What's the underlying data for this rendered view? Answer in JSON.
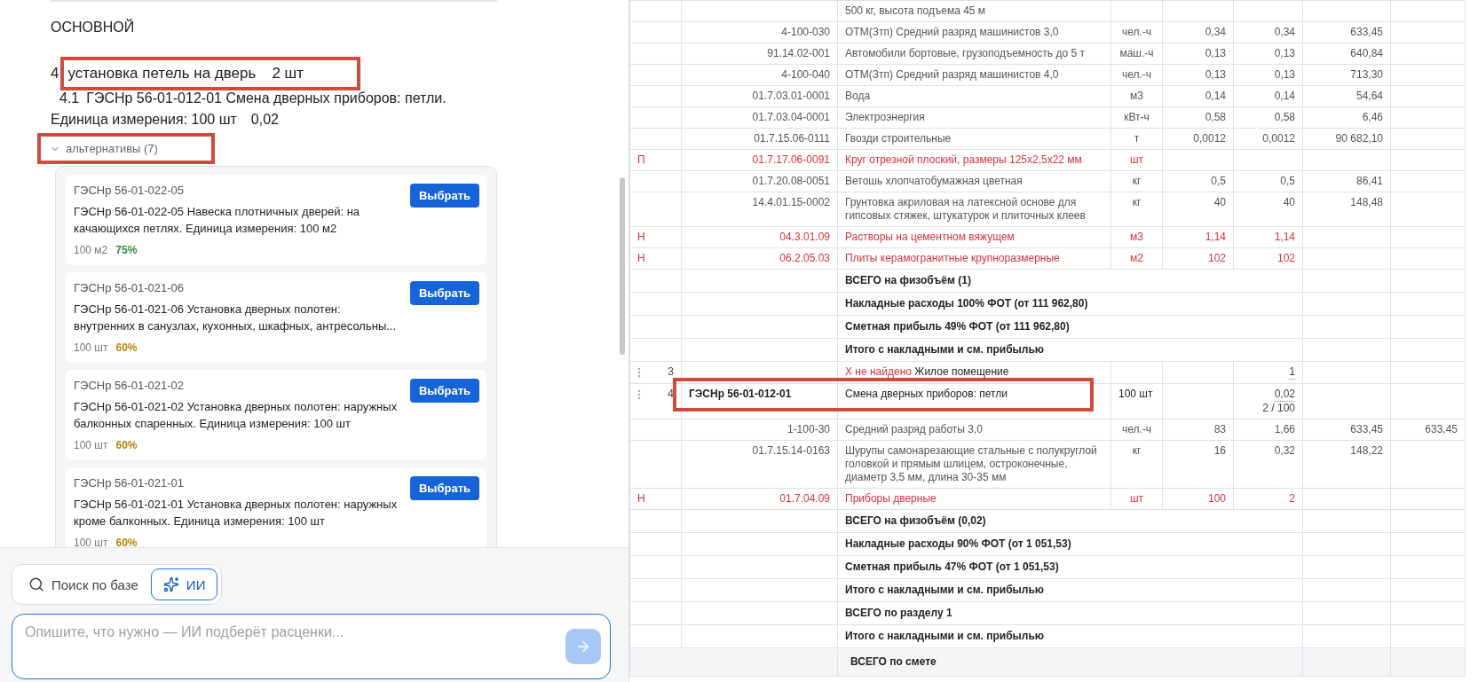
{
  "estimate": {
    "section": "ОСНОВНОЙ",
    "item": {
      "number": "4",
      "title": "установка петель на дверь",
      "quantity": "2 шт",
      "highlighted": true
    },
    "match": {
      "number": "4.1",
      "text": "ГЭСНр 56-01-012-01 Смена дверных приборов: петли."
    },
    "unit_line": {
      "label": "Единица измерения: 100 шт",
      "value": "0,02"
    },
    "alternatives": {
      "label": "альтернативы (7)",
      "expanded": true,
      "highlighted": true,
      "items": [
        {
          "code": "ГЭСНр 56-01-022-05",
          "description": "ГЭСНр 56-01-022-05 Навеска плотничных дверей: на качающихся петлях. Единица измерения: 100 м2",
          "unit": "100 м2",
          "score": "75%",
          "color": "#2e8b3a",
          "action": "Выбрать"
        },
        {
          "code": "ГЭСНр 56-01-021-06",
          "description": "ГЭСНр 56-01-021-06 Установка дверных полотен: внутренних в санузлах, кухонных, шкафных, антресольны...",
          "unit": "100 шт",
          "score": "60%",
          "color": "#b8860b",
          "action": "Выбрать"
        },
        {
          "code": "ГЭСНр 56-01-021-02",
          "description": "ГЭСНр 56-01-021-02 Установка дверных полотен: наружных балконных спаренных. Единица измерения: 100 шт",
          "unit": "100 шт",
          "score": "60%",
          "color": "#b8860b",
          "action": "Выбрать"
        },
        {
          "code": "ГЭСНр 56-01-021-01",
          "description": "ГЭСНр 56-01-021-01 Установка дверных полотен: наружных кроме балконных. Единица измерения: 100 шт",
          "unit": "100 шт",
          "score": "60%",
          "color": "#b8860b",
          "action": "Выбрать"
        }
      ]
    }
  },
  "composer": {
    "modes": [
      {
        "label": "Поиск по базе",
        "kind": "search",
        "selected": false
      },
      {
        "label": "ИИ",
        "kind": "ai",
        "selected": true
      }
    ],
    "placeholder": "Опишите, что нужно — ИИ подберёт расценки..."
  },
  "table": {
    "rows": [
      {
        "kind": "resource",
        "name": "500 кг, высота подъема 45 м"
      },
      {
        "kind": "resource",
        "code": "4-100-030",
        "name": "ОТМ(Зтп) Средний разряд машинистов 3,0",
        "unit": "чел.-ч",
        "norm": "0,34",
        "qty": "0,34",
        "price": "633,45"
      },
      {
        "kind": "resource",
        "code": "91.14.02-001",
        "name": "Автомобили бортовые, грузоподъемность до 5 т",
        "unit": "маш.-ч",
        "norm": "0,13",
        "qty": "0,13",
        "price": "640,84"
      },
      {
        "kind": "resource",
        "code": "4-100-040",
        "name": "ОТМ(Зтп) Средний разряд машинистов 4,0",
        "unit": "чел.-ч",
        "norm": "0,13",
        "qty": "0,13",
        "price": "713,30"
      },
      {
        "kind": "resource",
        "code": "01.7.03.01-0001",
        "name": "Вода",
        "unit": "м3",
        "norm": "0,14",
        "qty": "0,14",
        "price": "54,64"
      },
      {
        "kind": "resource",
        "code": "01.7.03.04-0001",
        "name": "Электроэнергия",
        "unit": "кВт-ч",
        "norm": "0,58",
        "qty": "0,58",
        "price": "6,46"
      },
      {
        "kind": "resource",
        "code": "01.7.15.06-0111",
        "name": "Гвозди строительные",
        "unit": "т",
        "norm": "0,0012",
        "qty": "0,0012",
        "price": "90 682,10"
      },
      {
        "kind": "alert",
        "flag": "П",
        "code": "01.7.17.06-0091",
        "name": "Круг отрезной плоский, размеры 125х2,5х22 мм",
        "unit": "шт"
      },
      {
        "kind": "resource",
        "code": "01.7.20.08-0051",
        "name": "Ветошь хлопчатобумажная цветная",
        "unit": "кг",
        "norm": "0,5",
        "qty": "0,5",
        "price": "86,41"
      },
      {
        "kind": "resource",
        "code": "14.4.01.15-0002",
        "name": "Грунтовка акриловая на латексной основе для гипсовых стяжек, штукатурок и плиточных клеев",
        "unit": "кг",
        "norm": "40",
        "qty": "40",
        "price": "148,48"
      },
      {
        "kind": "alert",
        "flag": "Н",
        "code": "04.3.01.09",
        "name": "Растворы на цементном вяжущем",
        "unit": "м3",
        "norm": "1,14",
        "qty": "1,14"
      },
      {
        "kind": "alert",
        "flag": "Н",
        "code": "06.2.05.03",
        "name": "Плиты керамогранитные крупноразмерные",
        "unit": "м2",
        "norm": "102",
        "qty": "102"
      },
      {
        "kind": "summary",
        "name": "ВСЕГО на физобъём (1)"
      },
      {
        "kind": "summary",
        "name": "Накладные расходы 100% ФОТ (от 111 962,80)"
      },
      {
        "kind": "summary",
        "name": "Сметная прибыль 49% ФОТ (от 111 962,80)"
      },
      {
        "kind": "summary",
        "name": "Итого с накладными и см. прибылью"
      },
      {
        "kind": "item",
        "number": "3",
        "status": "Х не найдено",
        "name": "Жилое помещение",
        "qty": "1",
        "highlighted": false
      },
      {
        "kind": "item",
        "number": "4",
        "code": "ГЭСНр 56-01-012-01",
        "name": "Смена дверных приборов: петли",
        "unit": "100 шт",
        "qty": "0,02",
        "formula": "2 / 100",
        "highlighted": true
      },
      {
        "kind": "resource",
        "code": "1-100-30",
        "name": "Средний разряд работы 3,0",
        "unit": "чел.-ч",
        "norm": "83",
        "qty": "1,66",
        "price": "633,45",
        "total": "633,45"
      },
      {
        "kind": "resource",
        "code": "01.7.15.14-0163",
        "name": "Шурупы самонарезающие стальные с полукруглой головкой и прямым шлицем, остроконечные, диаметр 3,5 мм, длина 30-35 мм",
        "unit": "кг",
        "norm": "16",
        "qty": "0,32",
        "price": "148,22"
      },
      {
        "kind": "alert",
        "flag": "Н",
        "code": "01.7.04.09",
        "name": "Приборы дверные",
        "unit": "шт",
        "norm": "100",
        "qty": "2"
      },
      {
        "kind": "summary",
        "name": "ВСЕГО на физобъём (0,02)"
      },
      {
        "kind": "summary",
        "name": "Накладные расходы 90% ФОТ (от 1 051,53)"
      },
      {
        "kind": "summary",
        "name": "Сметная прибыль 47% ФОТ (от 1 051,53)"
      },
      {
        "kind": "summary",
        "name": "Итого с накладными и см. прибылью"
      },
      {
        "kind": "summary",
        "name": "ВСЕГО по разделу 1"
      },
      {
        "kind": "summary",
        "name": "Итого с накладными и см. прибылью"
      },
      {
        "kind": "grand",
        "name": "ВСЕГО по смете"
      }
    ]
  }
}
